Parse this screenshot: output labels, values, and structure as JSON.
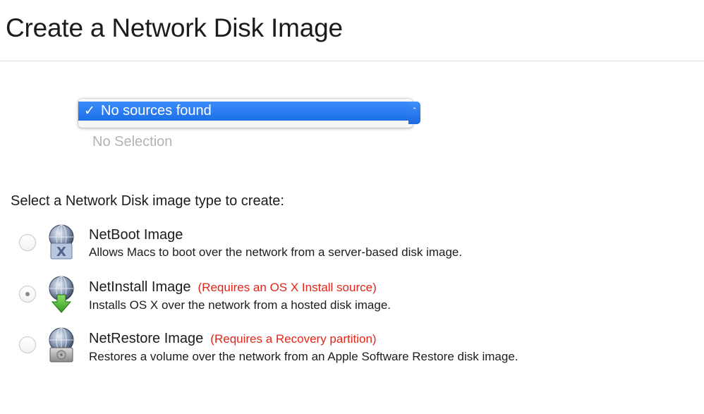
{
  "page": {
    "title": "Create a Network Disk Image"
  },
  "source_menu": {
    "selected_label": "No sources found",
    "check_glyph": "✓",
    "other_option_label": "No Selection"
  },
  "image_type": {
    "prompt": "Select a Network Disk image type to create:",
    "options": [
      {
        "title": "NetBoot Image",
        "requirement": "",
        "description": "Allows Macs to boot over the network from a server-based disk image.",
        "selected": false,
        "icon": "netboot-globe-x-icon"
      },
      {
        "title": "NetInstall Image",
        "requirement": "(Requires an OS X Install source)",
        "description": "Installs OS X over the network from a hosted disk image.",
        "selected": true,
        "icon": "netinstall-globe-arrow-icon"
      },
      {
        "title": "NetRestore Image",
        "requirement": "(Requires a Recovery partition)",
        "description": "Restores a volume over the network from an Apple Software Restore disk image.",
        "selected": false,
        "icon": "netrestore-globe-drive-icon"
      }
    ]
  },
  "colors": {
    "menu_highlight": "#1d6fe8",
    "requirement_text": "#e0261a",
    "disabled_text": "#b3b3b3"
  }
}
